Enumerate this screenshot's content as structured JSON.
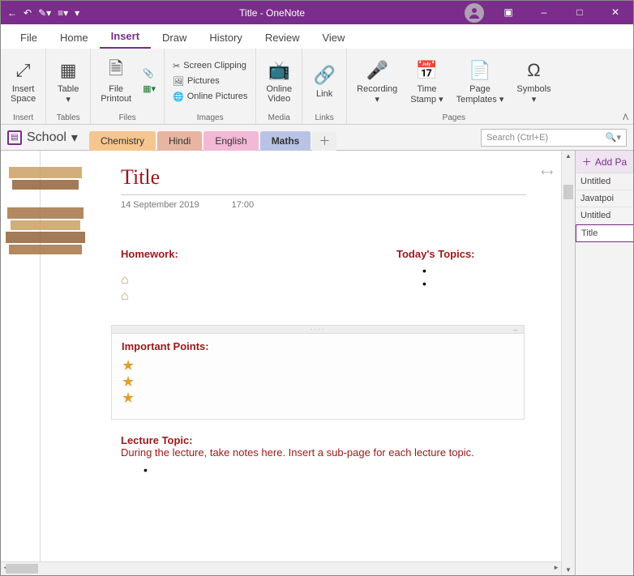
{
  "window": {
    "title": "Title - OneNote"
  },
  "menu": {
    "file": "File",
    "home": "Home",
    "insert": "Insert",
    "draw": "Draw",
    "history": "History",
    "review": "Review",
    "view": "View",
    "active": "insert"
  },
  "ribbon": {
    "insert_space": "Insert\nSpace",
    "table": "Table",
    "file_printout": "File\nPrintout",
    "screen_clipping": "Screen Clipping",
    "pictures": "Pictures",
    "online_pictures": "Online Pictures",
    "online_video": "Online\nVideo",
    "link": "Link",
    "recording": "Recording",
    "time_stamp": "Time\nStamp",
    "page_templates": "Page\nTemplates",
    "symbols": "Symbols",
    "groups": {
      "insert": "Insert",
      "tables": "Tables",
      "files": "Files",
      "images": "Images",
      "media": "Media",
      "links": "Links",
      "pages": "Pages"
    }
  },
  "notebook": {
    "name": "School"
  },
  "sections": [
    {
      "name": "Chemistry",
      "color": "#f5c68f"
    },
    {
      "name": "Hindi",
      "color": "#e7b5a0"
    },
    {
      "name": "English",
      "color": "#f3b8d5"
    },
    {
      "name": "Maths",
      "color": "#b9c3e6"
    }
  ],
  "active_section": 3,
  "search": {
    "placeholder": "Search (Ctrl+E)"
  },
  "page": {
    "title": "Title",
    "date": "14 September 2019",
    "time": "17:00",
    "homework": "Homework:",
    "topics": "Today's Topics:",
    "important": "Important Points:",
    "lecture_h": "Lecture Topic:",
    "lecture_body": "During the lecture, take notes here.  Insert a sub-page for each lecture topic."
  },
  "pages_panel": {
    "add": "Add Pa",
    "items": [
      "Untitled",
      "Javatpoi",
      "Untitled",
      "Title"
    ],
    "selected": 3
  }
}
